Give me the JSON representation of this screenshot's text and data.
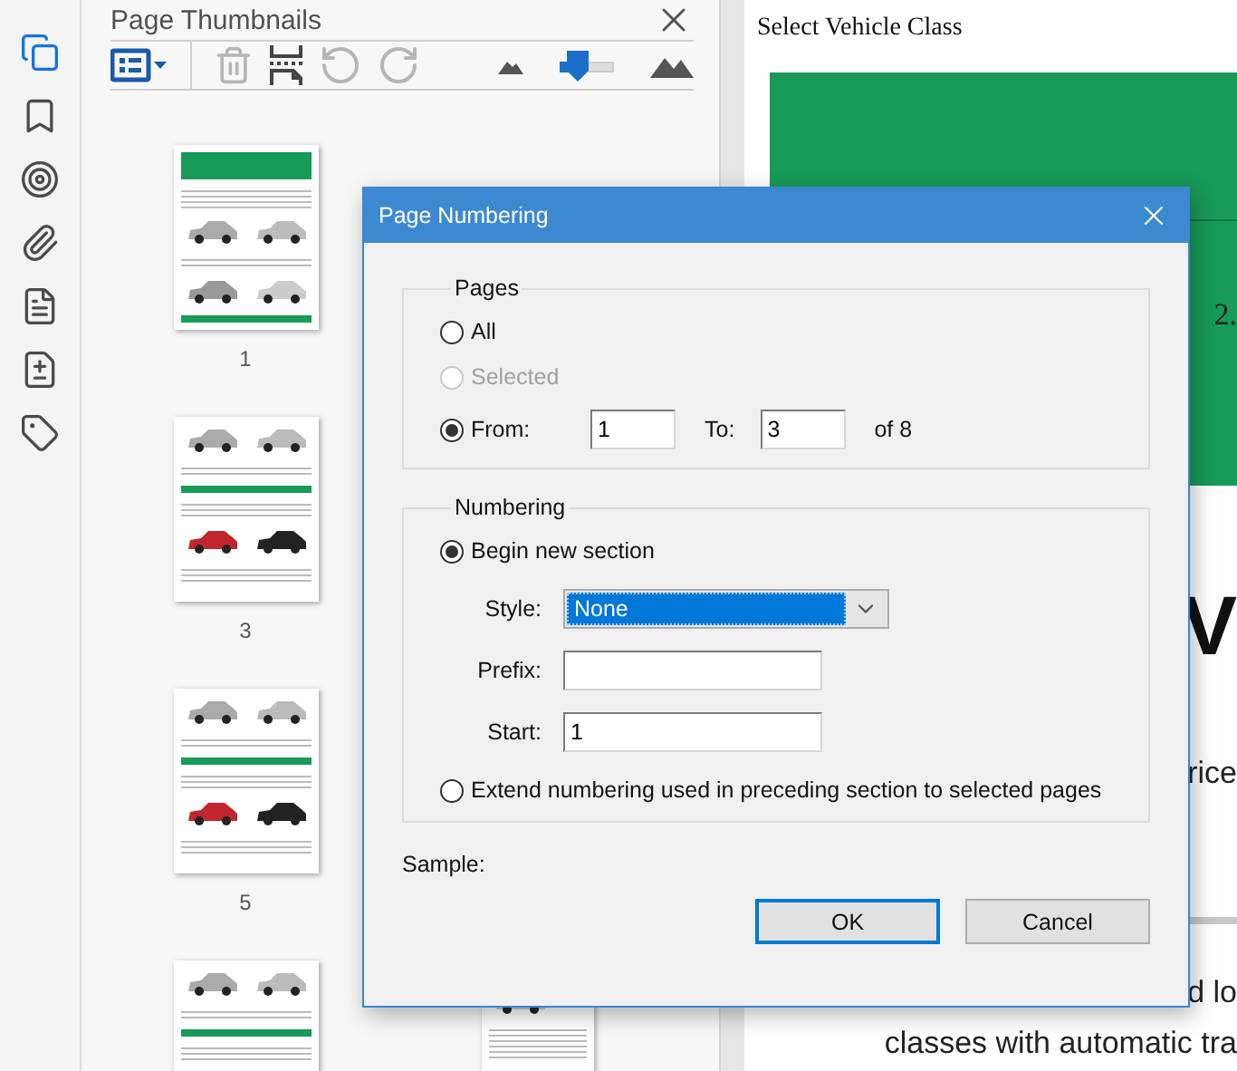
{
  "rail": [
    {
      "kind": "pages",
      "selected": true
    },
    {
      "kind": "bookmark",
      "selected": false
    },
    {
      "kind": "layers",
      "selected": false
    },
    {
      "kind": "attachment",
      "selected": false
    },
    {
      "kind": "document",
      "selected": false
    },
    {
      "kind": "compare",
      "selected": false
    },
    {
      "kind": "tag",
      "selected": false
    }
  ],
  "panel": {
    "title": "Page Thumbnails",
    "toolbar": [
      {
        "kind": "options",
        "disabled": false
      },
      {
        "kind": "delete",
        "disabled": true
      },
      {
        "kind": "insert",
        "disabled": false
      },
      {
        "kind": "rotate-left",
        "disabled": true
      },
      {
        "kind": "rotate-right",
        "disabled": true
      }
    ],
    "zoom": {
      "level": 0.2
    },
    "thumbnails": [
      {
        "label": "1",
        "kind": "cover"
      },
      {
        "label": "3",
        "kind": "cars"
      },
      {
        "label": "5",
        "kind": "cars"
      },
      {
        "kind": "cars"
      }
    ],
    "thumbnails_right": [
      {
        "kind": "wide"
      }
    ]
  },
  "document": {
    "heading": "Select Vehicle Class",
    "banner_text": "2.",
    "big_letter": "V",
    "line_1": "rice",
    "line_2": "d lo",
    "line_3": "classes with automatic tra"
  },
  "dialog": {
    "title": "Page Numbering",
    "pages": {
      "legend": "Pages",
      "options": [
        {
          "kind": "plain",
          "label": "All",
          "selected": false,
          "disabled": false
        },
        {
          "kind": "plain",
          "label": "Selected",
          "selected": false,
          "disabled": true
        },
        {
          "kind": "range",
          "label": "From:",
          "selected": true,
          "disabled": false,
          "from": "1",
          "to_label": "To:",
          "to": "3",
          "total": "of 8"
        }
      ]
    },
    "numbering": {
      "legend": "Numbering",
      "options": [
        {
          "kind": "section",
          "label": "Begin new section",
          "selected": true,
          "fields": [
            {
              "kind": "select",
              "label": "Style:",
              "value": "None"
            },
            {
              "kind": "text",
              "label": "Prefix:"
            },
            {
              "kind": "text",
              "label": "Start:",
              "value": "1"
            }
          ]
        },
        {
          "kind": "plain",
          "label": "Extend numbering used in preceding section to selected pages",
          "selected": false
        }
      ]
    },
    "sample_label": "Sample:",
    "buttons": [
      {
        "label": "OK",
        "default": true
      },
      {
        "label": "Cancel",
        "default": false
      }
    ]
  }
}
